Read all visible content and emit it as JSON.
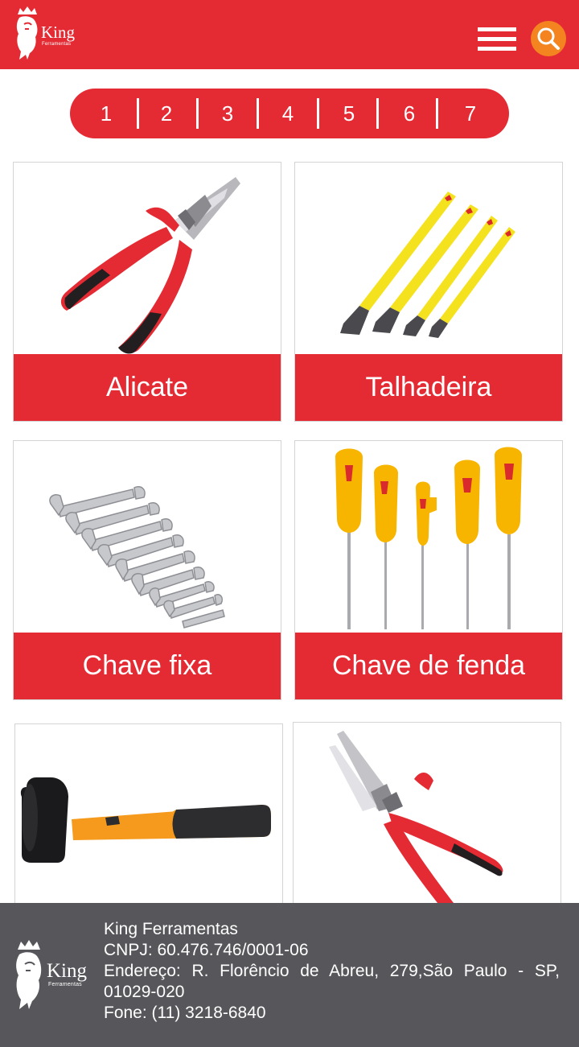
{
  "header": {
    "logo_text": "King",
    "logo_subtext": "Ferramentas",
    "menu_icon": "hamburger-icon",
    "search_icon": "search-icon",
    "colors": {
      "brand": "#e42b34",
      "search_button": "#f4841f"
    }
  },
  "pagination": {
    "pages": [
      "1",
      "2",
      "3",
      "4",
      "5",
      "6",
      "7"
    ]
  },
  "products": [
    {
      "label": "Alicate",
      "image": "pliers-image"
    },
    {
      "label": "Talhadeira",
      "image": "chisel-set-image"
    },
    {
      "label": "Chave fixa",
      "image": "wrench-set-image"
    },
    {
      "label": "Chave de fenda",
      "image": "screwdriver-set-image"
    },
    {
      "label": "",
      "image": "rubber-mallet-image"
    },
    {
      "label": "",
      "image": "pliers-image"
    }
  ],
  "footer": {
    "company": "King Ferramentas",
    "cnpj": "CNPJ: 60.476.746/0001-06",
    "address": "Endereço: R. Florêncio de Abreu, 279,São Paulo - SP, 01029-020",
    "phone": "Fone:  (11) 3218-6840",
    "logo_text": "King",
    "logo_subtext": "Ferramentas",
    "background": "#57565b"
  }
}
